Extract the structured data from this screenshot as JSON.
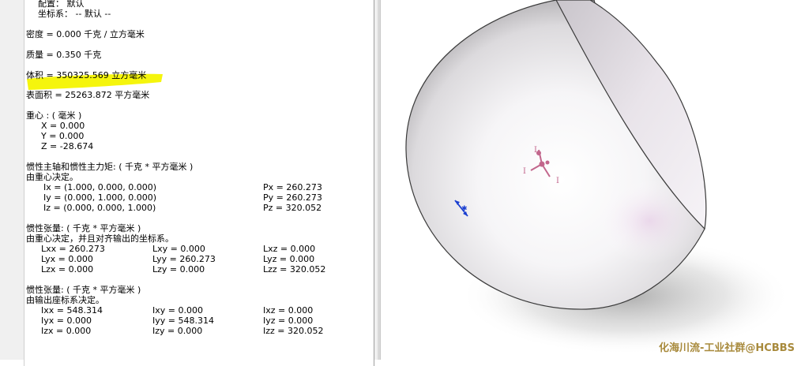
{
  "props": {
    "config": "配置： 默认",
    "coord_sys": "坐标系： -- 默认 --",
    "density": "密度 = 0.000 千克 / 立方毫米",
    "mass": "质量 = 0.350 千克",
    "volume": "体积 = 350325.569 立方毫米",
    "surface": "表面积 = 25263.872  平方毫米",
    "cog_title": "重心 : ( 毫米 )",
    "cog_x": "X = 0.000",
    "cog_y": "Y = 0.000",
    "cog_z": "Z = -28.674",
    "pa_title": "惯性主轴和惯性主力矩: ( 千克 *  平方毫米 )",
    "pa_sub": "由重心决定。",
    "pa_ix": "Ix = (1.000,  0.000,  0.000)",
    "pa_iy": "Iy = (0.000,  1.000,  0.000)",
    "pa_iz": "Iz = (0.000,  0.000,  1.000)",
    "pa_px": "Px = 260.273",
    "pa_py": "Py = 260.273",
    "pa_pz": "Pz = 320.052",
    "t1_title": "惯性张量: ( 千克 *  平方毫米 )",
    "t1_sub": "由重心决定，并且对齐输出的坐标系。",
    "t1": [
      [
        "Lxx = 260.273",
        "Lxy = 0.000",
        "Lxz = 0.000"
      ],
      [
        "Lyx = 0.000",
        "Lyy = 260.273",
        "Lyz = 0.000"
      ],
      [
        "Lzx = 0.000",
        "Lzy = 0.000",
        "Lzz = 320.052"
      ]
    ],
    "t2_title": "惯性张量: ( 千克 *  平方毫米 )",
    "t2_sub": "由输出座标系决定。",
    "t2": [
      [
        "Ixx = 548.314",
        "Ixy = 0.000",
        "Ixz = 0.000"
      ],
      [
        "Iyx = 0.000",
        "Iyy = 548.314",
        "Iyz = 0.000"
      ],
      [
        "Izx = 0.000",
        "Izy = 0.000",
        "Izz = 320.052"
      ]
    ]
  },
  "viewport": {
    "triad_labels": [
      "I",
      "I",
      "I"
    ],
    "watermark": "化海川流-工业社群@HCBBS"
  },
  "colors": {
    "highlight": "#f4f400",
    "watermark": "#a88a3c",
    "triad": "#c2668c",
    "cog_marker": "#1a3fd0"
  }
}
